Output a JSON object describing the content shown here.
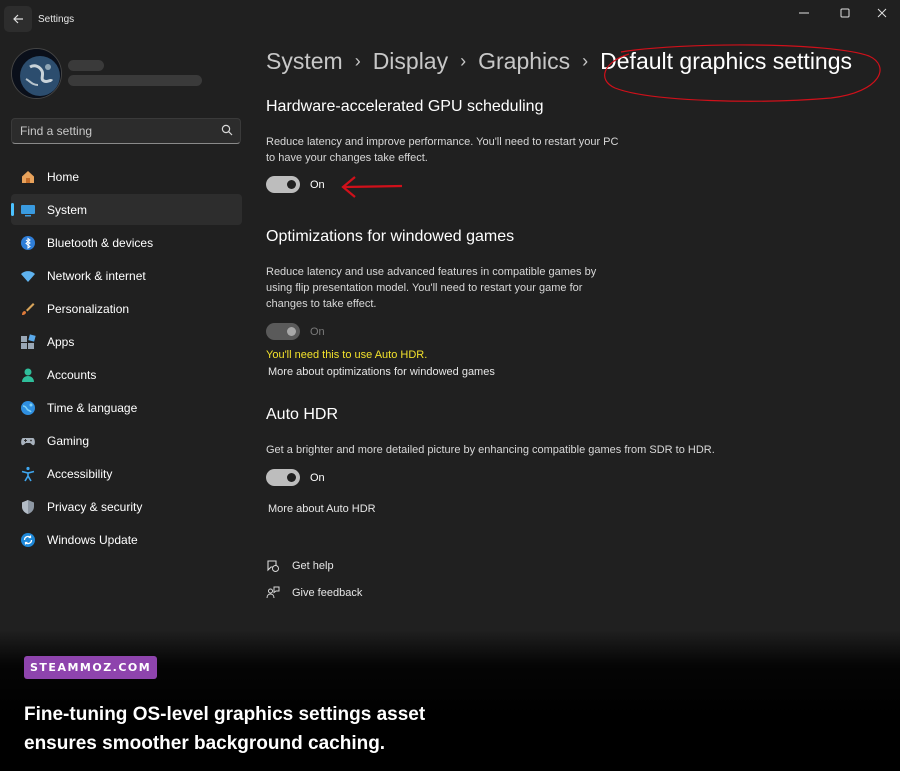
{
  "window": {
    "title": "Settings"
  },
  "sidebar": {
    "search_placeholder": "Find a setting",
    "items": [
      {
        "label": "Home",
        "icon": "home-icon"
      },
      {
        "label": "System",
        "icon": "system-icon",
        "active": true
      },
      {
        "label": "Bluetooth & devices",
        "icon": "bluetooth-icon"
      },
      {
        "label": "Network & internet",
        "icon": "network-icon"
      },
      {
        "label": "Personalization",
        "icon": "brush-icon"
      },
      {
        "label": "Apps",
        "icon": "apps-icon"
      },
      {
        "label": "Accounts",
        "icon": "accounts-icon"
      },
      {
        "label": "Time & language",
        "icon": "globe-icon"
      },
      {
        "label": "Gaming",
        "icon": "gamepad-icon"
      },
      {
        "label": "Accessibility",
        "icon": "accessibility-icon"
      },
      {
        "label": "Privacy & security",
        "icon": "shield-icon"
      },
      {
        "label": "Windows Update",
        "icon": "update-icon"
      }
    ]
  },
  "breadcrumb": [
    "System",
    "Display",
    "Graphics",
    "Default graphics settings"
  ],
  "sections": {
    "gpu_scheduling": {
      "title": "Hardware-accelerated GPU scheduling",
      "desc1": "Reduce latency and improve performance. You'll need to restart your PC",
      "desc2": "to have your changes take effect.",
      "toggle_label": "On",
      "toggle_on": true
    },
    "windowed_games": {
      "title": "Optimizations for windowed games",
      "desc1": "Reduce latency and use advanced features in compatible games by",
      "desc2": "using flip presentation model. You'll need to restart your game for",
      "desc3": "changes to take effect.",
      "toggle_label": "On",
      "toggle_on": true,
      "disabled": true,
      "warning": "You'll need this to use Auto HDR.",
      "link": "More about optimizations for windowed games"
    },
    "auto_hdr": {
      "title": "Auto HDR",
      "desc1": "Get a brighter and more detailed picture by enhancing compatible games from SDR to HDR.",
      "toggle_label": "On",
      "toggle_on": true,
      "link": "More about Auto HDR"
    }
  },
  "help": {
    "get_help": "Get help",
    "give_feedback": "Give feedback"
  },
  "overlay": {
    "badge": "STEAMMOZ.COM",
    "caption_line1": "Fine-tuning OS-level graphics settings asset",
    "caption_line2": "ensures smoother background caching."
  },
  "colors": {
    "background": "#202020",
    "accent": "#4cc2ff",
    "warning_text": "#f2e12c",
    "annotation_red": "#d0101a",
    "badge_purple": "#8e44ad"
  }
}
